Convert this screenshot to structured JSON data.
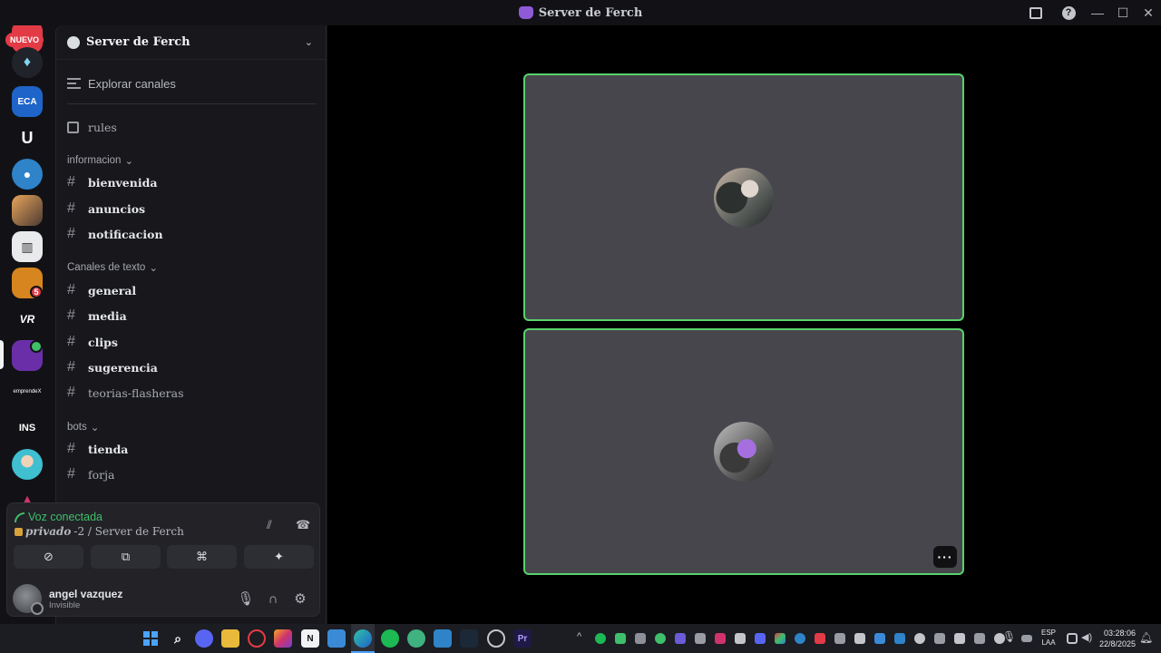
{
  "window": {
    "title": "Server de Ferch",
    "inbox_icon": "inbox-icon",
    "help_label": "?",
    "minimize_label": "—",
    "maximize_label": "☐",
    "close_label": "✕"
  },
  "rail": {
    "nuevo_label": "NUEVO",
    "servers": [
      {
        "name": "server-crystal",
        "label": "",
        "color": "#20242a"
      },
      {
        "name": "server-eca",
        "label": "ECA",
        "color": "#1f64c8"
      },
      {
        "name": "server-u",
        "label": "U",
        "color": "#121216"
      },
      {
        "name": "server-drop",
        "label": "",
        "color": "#2e83c9"
      },
      {
        "name": "server-car",
        "label": "",
        "color": "#a2643a"
      },
      {
        "name": "server-building",
        "label": "",
        "color": "#e9eaec"
      },
      {
        "name": "server-lion",
        "label": "",
        "color": "#d7861f"
      },
      {
        "name": "server-vr",
        "label": "VR",
        "color": "#121216"
      },
      {
        "name": "server-ferch",
        "label": "",
        "color": "#6a2fa8"
      },
      {
        "name": "server-emprende",
        "label": "emprendeX",
        "color": "#121216"
      },
      {
        "name": "server-ins",
        "label": "INS",
        "color": "#121216"
      },
      {
        "name": "server-avatar",
        "label": "",
        "color": "#3fbfd0"
      },
      {
        "name": "server-flame",
        "label": "",
        "color": "#d0336b"
      }
    ],
    "lion_badge": "5"
  },
  "sidebar": {
    "server_name": "Server de Ferch",
    "explore_label": "Explorar canales",
    "rules_label": "rules",
    "categories": [
      {
        "label": "informacion",
        "channels": [
          "bienvenida",
          "anuncios",
          "notificacion"
        ]
      },
      {
        "label": "Canales de texto",
        "channels": [
          "general",
          "media",
          "clips",
          "sugerencia",
          "teorias-flasheras"
        ]
      },
      {
        "label": "bots",
        "channels": [
          "tienda",
          "forja"
        ]
      }
    ]
  },
  "voice": {
    "status": "Voz conectada",
    "channel_bold": "privado",
    "channel_rest": "-2 / Server de Ferch"
  },
  "user": {
    "name": "angel vazquez",
    "status": "Invisible"
  },
  "stage": {
    "tiles": [
      {
        "name": "participant-tile-1",
        "avatar_class": "av1"
      },
      {
        "name": "participant-tile-2",
        "avatar_class": "av2"
      }
    ],
    "more_label": "···"
  },
  "taskbar": {
    "lang_top": "ESP",
    "lang_bottom": "LAA",
    "time": "03:28:06",
    "date": "22/8/2025"
  }
}
